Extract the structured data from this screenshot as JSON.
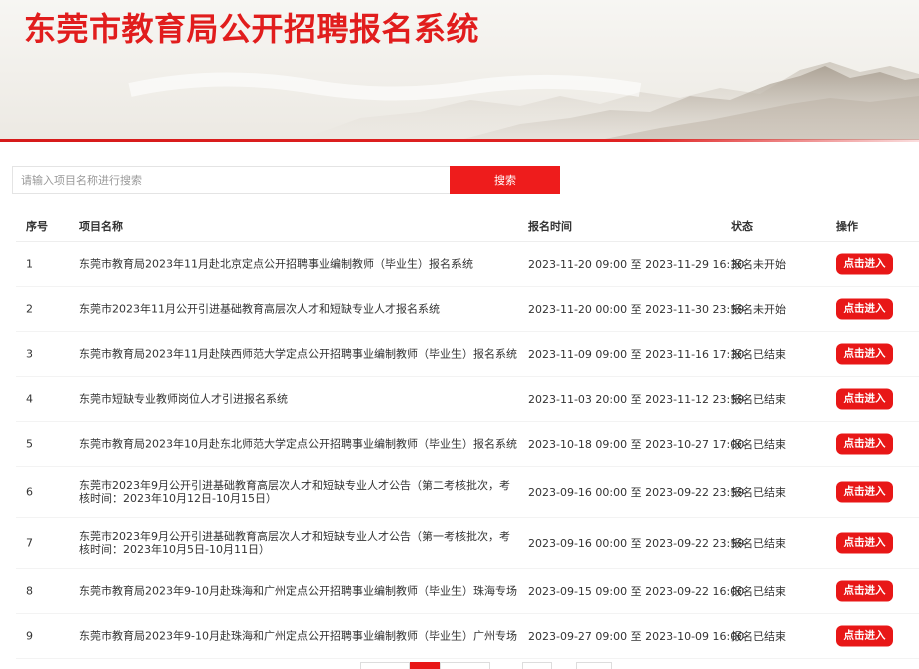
{
  "header": {
    "title": "东莞市教育局公开招聘报名系统"
  },
  "search": {
    "placeholder": "请输入项目名称进行搜索",
    "button_label": "搜索"
  },
  "table": {
    "columns": [
      "序号",
      "项目名称",
      "报名时间",
      "状态",
      "操作"
    ],
    "rows": [
      {
        "no": "1",
        "name": "东莞市教育局2023年11月赴北京定点公开招聘事业编制教师（毕业生）报名系统",
        "time": "2023-11-20 09:00 至 2023-11-29 16:30",
        "status": "报名未开始",
        "action": "点击进入"
      },
      {
        "no": "2",
        "name": "东莞市2023年11月公开引进基础教育高层次人才和短缺专业人才报名系统",
        "time": "2023-11-20 00:00 至 2023-11-30 23:59",
        "status": "报名未开始",
        "action": "点击进入"
      },
      {
        "no": "3",
        "name": "东莞市教育局2023年11月赴陕西师范大学定点公开招聘事业编制教师（毕业生）报名系统",
        "time": "2023-11-09 09:00 至 2023-11-16 17:30",
        "status": "报名已结束",
        "action": "点击进入"
      },
      {
        "no": "4",
        "name": "东莞市短缺专业教师岗位人才引进报名系统",
        "time": "2023-11-03 20:00 至 2023-11-12 23:59",
        "status": "报名已结束",
        "action": "点击进入"
      },
      {
        "no": "5",
        "name": "东莞市教育局2023年10月赴东北师范大学定点公开招聘事业编制教师（毕业生）报名系统",
        "time": "2023-10-18 09:00 至 2023-10-27 17:00",
        "status": "报名已结束",
        "action": "点击进入"
      },
      {
        "no": "6",
        "name": "东莞市2023年9月公开引进基础教育高层次人才和短缺专业人才公告（第二考核批次，考核时间：2023年10月12日-10月15日）",
        "time": "2023-09-16 00:00 至 2023-09-22 23:59",
        "status": "报名已结束",
        "action": "点击进入"
      },
      {
        "no": "7",
        "name": "东莞市2023年9月公开引进基础教育高层次人才和短缺专业人才公告（第一考核批次，考核时间：2023年10月5日-10月11日）",
        "time": "2023-09-16 00:00 至 2023-09-22 23:59",
        "status": "报名已结束",
        "action": "点击进入"
      },
      {
        "no": "8",
        "name": "东莞市教育局2023年9-10月赴珠海和广州定点公开招聘事业编制教师（毕业生）珠海专场",
        "time": "2023-09-15 09:00 至 2023-09-22 16:00",
        "status": "报名已结束",
        "action": "点击进入"
      },
      {
        "no": "9",
        "name": "东莞市教育局2023年9-10月赴珠海和广州定点公开招聘事业编制教师（毕业生）广州专场",
        "time": "2023-09-27 09:00 至 2023-10-09 16:00",
        "status": "报名已结束",
        "action": "点击进入"
      }
    ]
  },
  "colors": {
    "brand_red": "#e11d1d",
    "button_red": "#e81717"
  }
}
